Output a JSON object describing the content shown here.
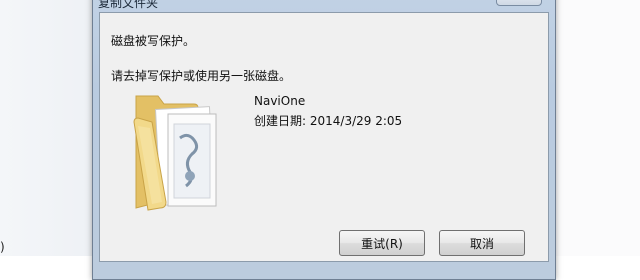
{
  "background": {
    "left_partial_text": ")"
  },
  "dialog": {
    "title": "复制文件夹",
    "message_line1": "磁盘被写保护。",
    "message_line2": "请去掉写保护或使用另一张磁盘。",
    "item": {
      "name": "NaviOne",
      "created": "创建日期: 2014/3/29 2:05",
      "icon": "folder-icon"
    },
    "buttons": {
      "retry": "重试(R)",
      "cancel": "取消"
    }
  },
  "colors": {
    "frame": "#bccbdd",
    "client": "#f0f0f0",
    "folder": "#efd37e"
  }
}
